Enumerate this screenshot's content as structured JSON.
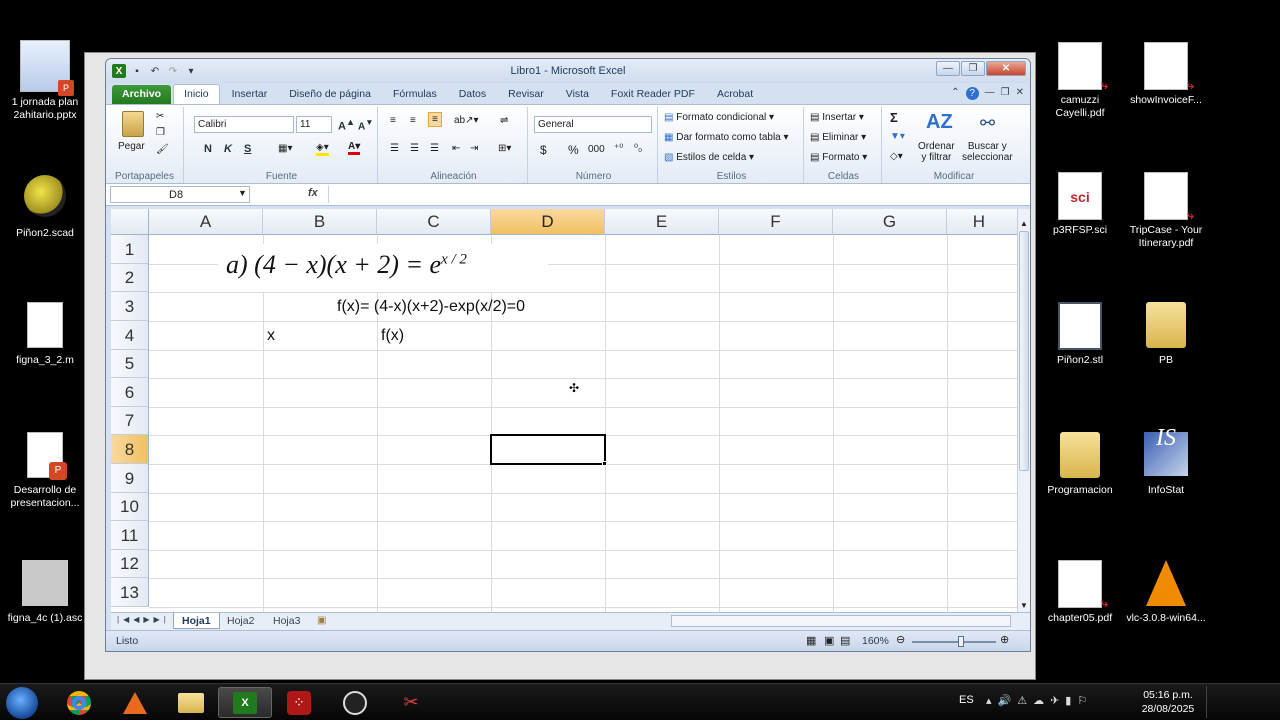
{
  "desktop_left": [
    {
      "label": "1 jornada plan\n2ahitario.pptx"
    },
    {
      "label": "Piñon2.scad"
    },
    {
      "label": "figna_3_2.m"
    },
    {
      "label": "Desarrollo de\npresentacion..."
    },
    {
      "label": "figna_4c (1).asc"
    }
  ],
  "desktop_right": [
    {
      "label": "camuzzi\nCayelli.pdf"
    },
    {
      "label": "showInvoiceF..."
    },
    {
      "label": "p3RFSP.sci"
    },
    {
      "label": "TripCase - Your\nItinerary.pdf"
    },
    {
      "label": "Piñon2.stl"
    },
    {
      "label": "PB"
    },
    {
      "label": "Programacion"
    },
    {
      "label": "InfoStat"
    },
    {
      "label": "chapter05.pdf"
    },
    {
      "label": "vlc-3.0.8-win64..."
    }
  ],
  "excel": {
    "title": "Libro1  -  Microsoft Excel",
    "tabs": [
      "Archivo",
      "Inicio",
      "Insertar",
      "Diseño de página",
      "Fórmulas",
      "Datos",
      "Revisar",
      "Vista",
      "Foxit Reader PDF",
      "Acrobat"
    ],
    "ribbon": {
      "clipboard": {
        "paste": "Pegar",
        "group": "Portapapeles"
      },
      "font": {
        "name": "Calibri",
        "size": "11",
        "bold": "N",
        "italic": "K",
        "underline": "S",
        "group": "Fuente"
      },
      "alignment": {
        "group": "Alineación"
      },
      "number": {
        "format": "General",
        "currency": "$",
        "percent": "%",
        "thousands": "000",
        "group": "Número"
      },
      "styles": {
        "conditional": "Formato condicional",
        "table": "Dar formato como tabla",
        "cell": "Estilos de celda",
        "group": "Estilos"
      },
      "cells": {
        "insert": "Insertar",
        "delete": "Eliminar",
        "format": "Formato",
        "group": "Celdas"
      },
      "editing": {
        "sum": "Σ",
        "sort": "Ordenar\ny filtrar",
        "find": "Buscar y\nseleccionar",
        "group": "Modificar"
      }
    },
    "namebox": "D8",
    "fx": "fx",
    "columns": [
      "A",
      "B",
      "C",
      "D",
      "E",
      "F",
      "G",
      "H"
    ],
    "rows": [
      "1",
      "2",
      "3",
      "4",
      "5",
      "6",
      "7",
      "8",
      "9",
      "10",
      "11",
      "12",
      "13"
    ],
    "equation_image": "a)  (4 − x)(x + 2) = e",
    "equation_exp": "x / 2",
    "cells": {
      "B3": "f(x)= (4-x)(x+2)-exp(x/2)=0",
      "B4": "x",
      "C4": "f(x)"
    },
    "sheets": [
      "Hoja1",
      "Hoja2",
      "Hoja3"
    ],
    "status": "Listo",
    "zoom": "160%"
  },
  "taskbar": {
    "language": "ES",
    "time": "05:16 p.m.",
    "date": "28/08/2025"
  }
}
